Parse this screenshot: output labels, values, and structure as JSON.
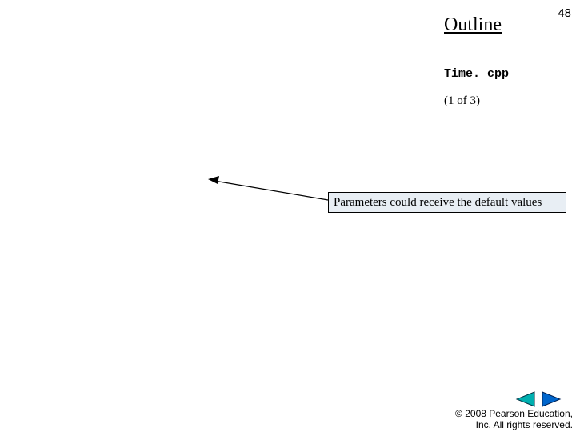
{
  "page_number": "48",
  "outline_title": "Outline",
  "filename": "Time. cpp",
  "pager_text": "(1 of 3)",
  "annotation": "Parameters could receive the default values",
  "copyright_line1": "© 2008 Pearson Education,",
  "copyright_line2": "Inc.  All rights reserved.",
  "nav": {
    "prev_color": "#00b0b0",
    "next_color": "#0066cc"
  }
}
